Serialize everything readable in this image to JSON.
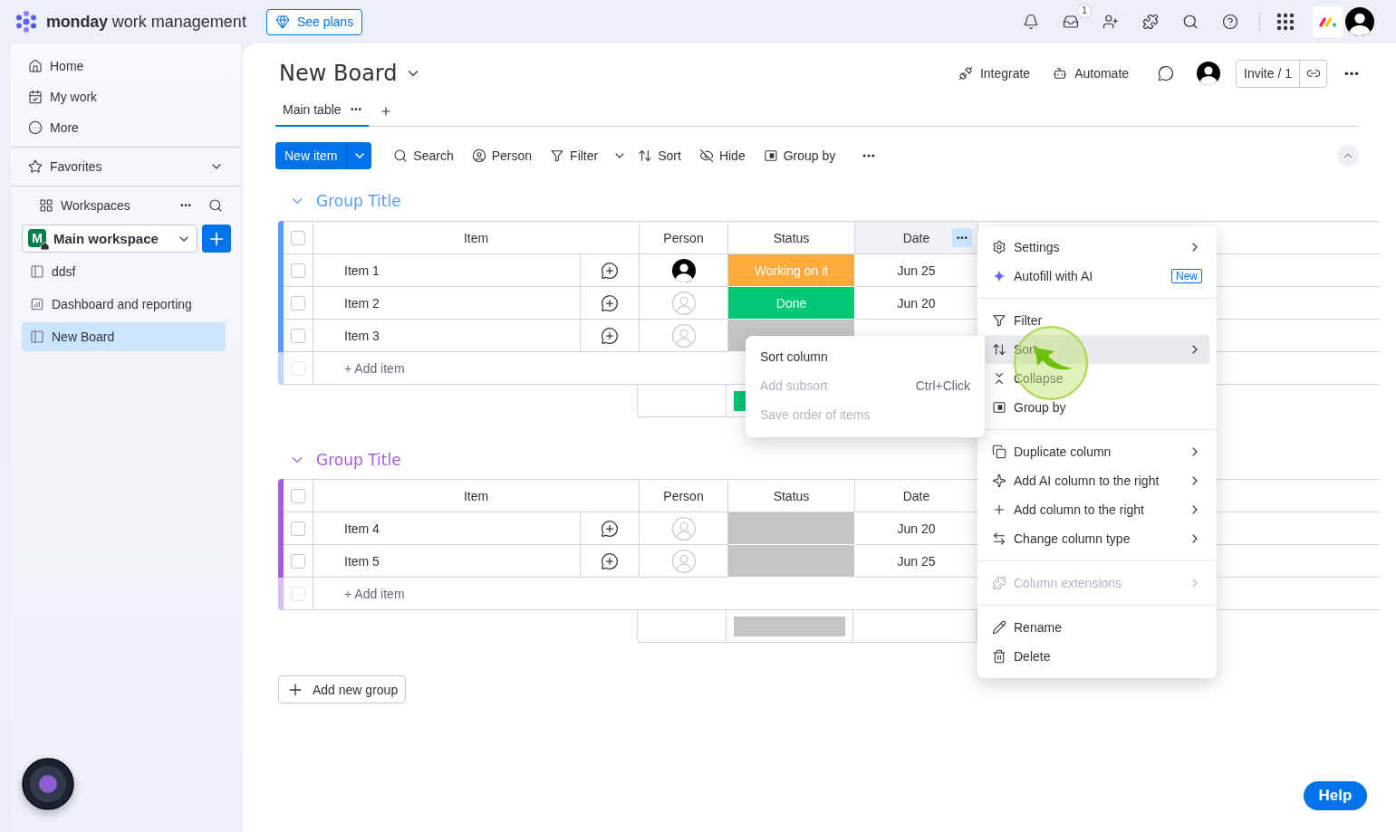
{
  "top_bar": {
    "brand": "monday",
    "product": "work management",
    "see_plans": "See plans",
    "inbox_badge": "1"
  },
  "sidebar": {
    "nav": [
      {
        "label": "Home",
        "kind": "home"
      },
      {
        "label": "My work",
        "kind": "my-work"
      },
      {
        "label": "More",
        "kind": "more"
      }
    ],
    "favorites": "Favorites",
    "workspaces": "Workspaces",
    "workspace": {
      "initial": "M",
      "name": "Main workspace"
    },
    "boards": [
      {
        "label": "ddsf",
        "kind": "board",
        "selected": false
      },
      {
        "label": "Dashboard and reporting",
        "kind": "dashboard",
        "selected": false
      },
      {
        "label": "New Board",
        "kind": "board",
        "selected": true
      }
    ]
  },
  "board": {
    "title": "New Board",
    "actions": [
      {
        "label": "Integrate",
        "kind": "integrate"
      },
      {
        "label": "Automate",
        "kind": "automate"
      }
    ],
    "invite": "Invite / 1",
    "views": [
      {
        "label": "Main table",
        "selected": true
      }
    ]
  },
  "toolbar": {
    "new_item": "New item",
    "tools": [
      {
        "label": "Search",
        "kind": "search",
        "dropdown": false
      },
      {
        "label": "Person",
        "kind": "person",
        "dropdown": false
      },
      {
        "label": "Filter",
        "kind": "filter",
        "dropdown": true
      },
      {
        "label": "Sort",
        "kind": "sort",
        "dropdown": false
      },
      {
        "label": "Hide",
        "kind": "hide",
        "dropdown": false
      },
      {
        "label": "Group by",
        "kind": "group-by",
        "dropdown": false
      }
    ]
  },
  "groups": [
    {
      "title": "Group Title",
      "color": "#579bfc",
      "all_checked": false,
      "columns": [
        {
          "label": "Item",
          "menu_open": false
        },
        {
          "label": "Person",
          "menu_open": false
        },
        {
          "label": "Status",
          "menu_open": false
        },
        {
          "label": "Date",
          "menu_open": true
        }
      ],
      "rows": [
        {
          "item": "Item 1",
          "checked": false,
          "assigned": true,
          "status": {
            "label": "Working on it",
            "color": "#fdab3d"
          },
          "date": "Jun 25"
        },
        {
          "item": "Item 2",
          "checked": false,
          "assigned": false,
          "status": {
            "label": "Done",
            "color": "#00c875"
          },
          "date": "Jun 20"
        },
        {
          "item": "Item 3",
          "checked": false,
          "assigned": false,
          "status": {
            "color": "#c4c4c4"
          }
        }
      ],
      "add_item": {
        "placeholder": "+ Add item",
        "checked": false
      },
      "summary": [
        {
          "color": "#00c875"
        }
      ]
    },
    {
      "title": "Group Title",
      "color": "#a25ddc",
      "all_checked": false,
      "columns": [
        {
          "label": "Item",
          "menu_open": false
        },
        {
          "label": "Person",
          "menu_open": false
        },
        {
          "label": "Status",
          "menu_open": false
        },
        {
          "label": "Date",
          "menu_open": false
        }
      ],
      "rows": [
        {
          "item": "Item 4",
          "checked": false,
          "assigned": false,
          "status": {
            "color": "#c4c4c4"
          },
          "date": "Jun 20"
        },
        {
          "item": "Item 5",
          "checked": false,
          "assigned": false,
          "status": {
            "color": "#c4c4c4"
          },
          "date": "Jun 25"
        }
      ],
      "add_item": {
        "placeholder": "+ Add item",
        "checked": false
      },
      "summary": [
        {
          "color": "#c4c4c4"
        }
      ]
    }
  ],
  "add_group": "Add new group",
  "column_menu": {
    "sections": [
      [
        {
          "label": "Settings",
          "kind": "settings",
          "submenu": true,
          "selected": false,
          "disabled": false
        },
        {
          "label": "Autofill with AI",
          "kind": "ai",
          "submenu": false,
          "selected": false,
          "disabled": false,
          "badge": "New"
        }
      ],
      [
        {
          "label": "Filter",
          "kind": "filter",
          "submenu": false,
          "selected": false,
          "disabled": false
        },
        {
          "label": "Sort",
          "kind": "sort",
          "submenu": true,
          "selected": true,
          "disabled": false
        },
        {
          "label": "Collapse",
          "kind": "collapse",
          "submenu": false,
          "selected": false,
          "disabled": false
        },
        {
          "label": "Group by",
          "kind": "group-by",
          "submenu": false,
          "selected": false,
          "disabled": false
        }
      ],
      [
        {
          "label": "Duplicate column",
          "kind": "duplicate",
          "submenu": true,
          "selected": false,
          "disabled": false
        },
        {
          "label": "Add AI column to the right",
          "kind": "ai-column",
          "submenu": true,
          "selected": false,
          "disabled": false
        },
        {
          "label": "Add column to the right",
          "kind": "add",
          "submenu": true,
          "selected": false,
          "disabled": false
        },
        {
          "label": "Change column type",
          "kind": "change-type",
          "submenu": true,
          "selected": false,
          "disabled": false
        }
      ],
      [
        {
          "label": "Column extensions",
          "kind": "extensions",
          "submenu": true,
          "selected": false,
          "disabled": true
        }
      ],
      [
        {
          "label": "Rename",
          "kind": "rename",
          "submenu": false,
          "selected": false,
          "disabled": false
        },
        {
          "label": "Delete",
          "kind": "delete",
          "submenu": false,
          "selected": false,
          "disabled": false
        }
      ]
    ]
  },
  "sort_submenu": {
    "items": [
      {
        "label": "Sort column",
        "disabled": false
      },
      {
        "label": "Add subsort",
        "disabled": true,
        "shortcut": "Ctrl+Click"
      },
      {
        "label": "Save order of items",
        "disabled": true
      }
    ]
  },
  "help": "Help"
}
